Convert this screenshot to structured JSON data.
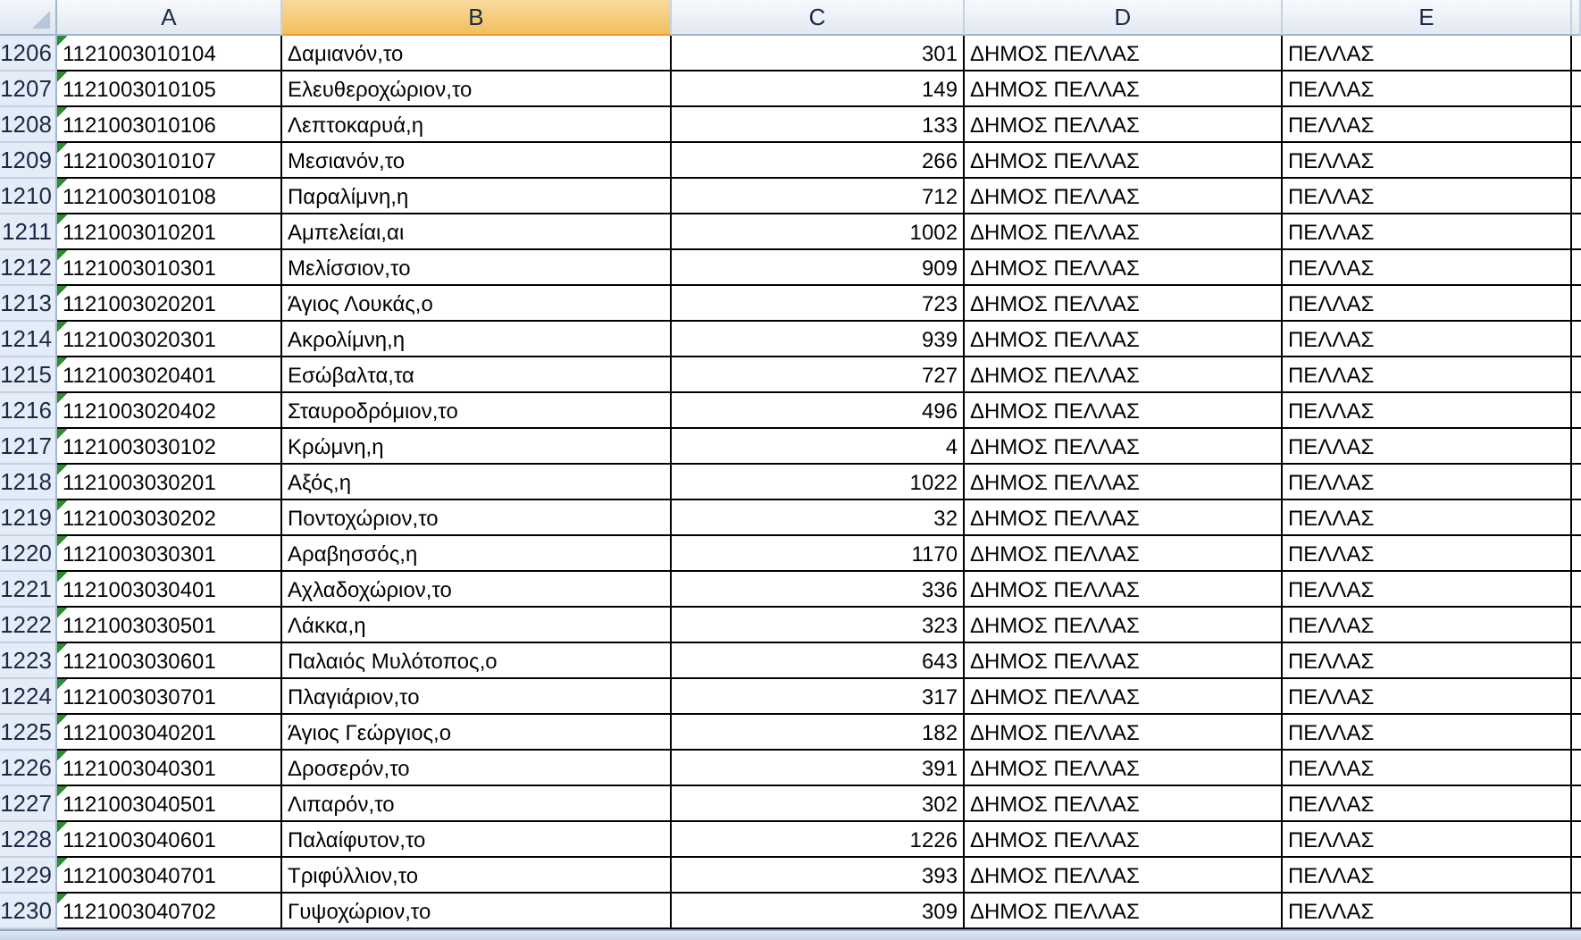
{
  "columns": [
    {
      "label": "A",
      "selected": false
    },
    {
      "label": "B",
      "selected": true
    },
    {
      "label": "C",
      "selected": false
    },
    {
      "label": "D",
      "selected": false
    },
    {
      "label": "E",
      "selected": false
    }
  ],
  "rows": [
    {
      "row": "1206",
      "cells": [
        "1121003010104",
        "Δαμιανόν,το",
        "301",
        "ΔΗΜΟΣ ΠΕΛΛΑΣ",
        "ΠΕΛΛΑΣ"
      ]
    },
    {
      "row": "1207",
      "cells": [
        "1121003010105",
        "Ελευθεροχώριον,το",
        "149",
        "ΔΗΜΟΣ ΠΕΛΛΑΣ",
        "ΠΕΛΛΑΣ"
      ]
    },
    {
      "row": "1208",
      "cells": [
        "1121003010106",
        "Λεπτοκαρυά,η",
        "133",
        "ΔΗΜΟΣ ΠΕΛΛΑΣ",
        "ΠΕΛΛΑΣ"
      ]
    },
    {
      "row": "1209",
      "cells": [
        "1121003010107",
        "Μεσιανόν,το",
        "266",
        "ΔΗΜΟΣ ΠΕΛΛΑΣ",
        "ΠΕΛΛΑΣ"
      ]
    },
    {
      "row": "1210",
      "cells": [
        "1121003010108",
        "Παραλίμνη,η",
        "712",
        "ΔΗΜΟΣ ΠΕΛΛΑΣ",
        "ΠΕΛΛΑΣ"
      ]
    },
    {
      "row": "1211",
      "cells": [
        "1121003010201",
        "Αμπελείαι,αι",
        "1002",
        "ΔΗΜΟΣ ΠΕΛΛΑΣ",
        "ΠΕΛΛΑΣ"
      ]
    },
    {
      "row": "1212",
      "cells": [
        "1121003010301",
        "Μελίσσιον,το",
        "909",
        "ΔΗΜΟΣ ΠΕΛΛΑΣ",
        "ΠΕΛΛΑΣ"
      ]
    },
    {
      "row": "1213",
      "cells": [
        "1121003020201",
        "Άγιος Λουκάς,ο",
        "723",
        "ΔΗΜΟΣ ΠΕΛΛΑΣ",
        "ΠΕΛΛΑΣ"
      ]
    },
    {
      "row": "1214",
      "cells": [
        "1121003020301",
        "Ακρολίμνη,η",
        "939",
        "ΔΗΜΟΣ ΠΕΛΛΑΣ",
        "ΠΕΛΛΑΣ"
      ]
    },
    {
      "row": "1215",
      "cells": [
        "1121003020401",
        "Εσώβαλτα,τα",
        "727",
        "ΔΗΜΟΣ ΠΕΛΛΑΣ",
        "ΠΕΛΛΑΣ"
      ]
    },
    {
      "row": "1216",
      "cells": [
        "1121003020402",
        "Σταυροδρόμιον,το",
        "496",
        "ΔΗΜΟΣ ΠΕΛΛΑΣ",
        "ΠΕΛΛΑΣ"
      ]
    },
    {
      "row": "1217",
      "cells": [
        "1121003030102",
        "Κρώμνη,η",
        "4",
        "ΔΗΜΟΣ ΠΕΛΛΑΣ",
        "ΠΕΛΛΑΣ"
      ]
    },
    {
      "row": "1218",
      "cells": [
        "1121003030201",
        "Αξός,η",
        "1022",
        "ΔΗΜΟΣ ΠΕΛΛΑΣ",
        "ΠΕΛΛΑΣ"
      ]
    },
    {
      "row": "1219",
      "cells": [
        "1121003030202",
        "Ποντοχώριον,το",
        "32",
        "ΔΗΜΟΣ ΠΕΛΛΑΣ",
        "ΠΕΛΛΑΣ"
      ]
    },
    {
      "row": "1220",
      "cells": [
        "1121003030301",
        "Αραβησσός,η",
        "1170",
        "ΔΗΜΟΣ ΠΕΛΛΑΣ",
        "ΠΕΛΛΑΣ"
      ]
    },
    {
      "row": "1221",
      "cells": [
        "1121003030401",
        "Αχλαδοχώριον,το",
        "336",
        "ΔΗΜΟΣ ΠΕΛΛΑΣ",
        "ΠΕΛΛΑΣ"
      ]
    },
    {
      "row": "1222",
      "cells": [
        "1121003030501",
        "Λάκκα,η",
        "323",
        "ΔΗΜΟΣ ΠΕΛΛΑΣ",
        "ΠΕΛΛΑΣ"
      ]
    },
    {
      "row": "1223",
      "cells": [
        "1121003030601",
        "Παλαιός Μυλότοπος,ο",
        "643",
        "ΔΗΜΟΣ ΠΕΛΛΑΣ",
        "ΠΕΛΛΑΣ"
      ]
    },
    {
      "row": "1224",
      "cells": [
        "1121003030701",
        "Πλαγιάριον,το",
        "317",
        "ΔΗΜΟΣ ΠΕΛΛΑΣ",
        "ΠΕΛΛΑΣ"
      ]
    },
    {
      "row": "1225",
      "cells": [
        "1121003040201",
        "Άγιος Γεώργιος,ο",
        "182",
        "ΔΗΜΟΣ ΠΕΛΛΑΣ",
        "ΠΕΛΛΑΣ"
      ]
    },
    {
      "row": "1226",
      "cells": [
        "1121003040301",
        "Δροσερόν,το",
        "391",
        "ΔΗΜΟΣ ΠΕΛΛΑΣ",
        "ΠΕΛΛΑΣ"
      ]
    },
    {
      "row": "1227",
      "cells": [
        "1121003040501",
        "Λιπαρόν,το",
        "302",
        "ΔΗΜΟΣ ΠΕΛΛΑΣ",
        "ΠΕΛΛΑΣ"
      ]
    },
    {
      "row": "1228",
      "cells": [
        "1121003040601",
        "Παλαίφυτον,το",
        "1226",
        "ΔΗΜΟΣ ΠΕΛΛΑΣ",
        "ΠΕΛΛΑΣ"
      ]
    },
    {
      "row": "1229",
      "cells": [
        "1121003040701",
        "Τριφύλλιον,το",
        "393",
        "ΔΗΜΟΣ ΠΕΛΛΑΣ",
        "ΠΕΛΛΑΣ"
      ]
    },
    {
      "row": "1230",
      "cells": [
        "1121003040702",
        "Γυψοχώριον,το",
        "309",
        "ΔΗΜΟΣ ΠΕΛΛΑΣ",
        "ΠΕΛΛΑΣ"
      ]
    }
  ]
}
